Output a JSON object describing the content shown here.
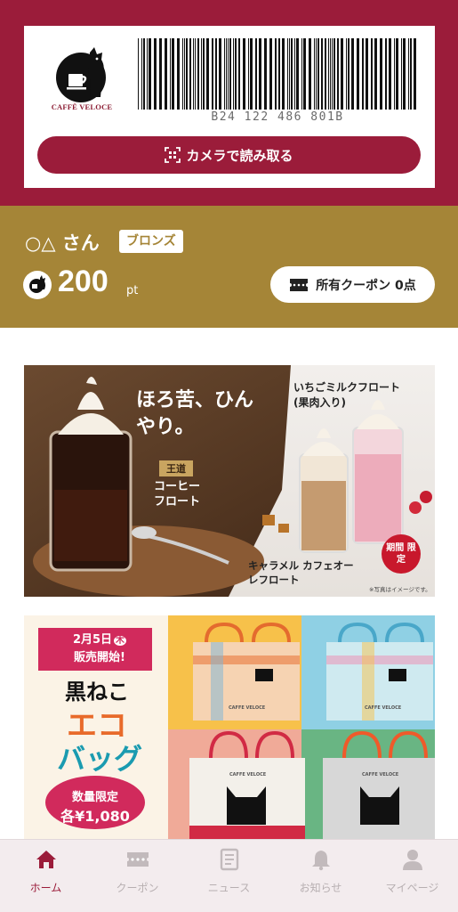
{
  "barcode": {
    "number": "B24 122 486 801B",
    "scan_button_label": "カメラで読み取る"
  },
  "brand": {
    "logo_text": "CAFFÈ VELOCE",
    "primary_color": "#9b1c3a",
    "gold_color": "#a58537"
  },
  "member": {
    "name": "○△ さん",
    "rank": "ブロンズ",
    "points": "200",
    "points_unit": "pt",
    "coupon_label": "所有クーポン 0点"
  },
  "banners": {
    "float": {
      "headline": "ほろ苦、ひんやり。",
      "item1_tag": "王道",
      "item1": "コーヒー フロート",
      "item2": "いちごミルクフロート",
      "item2_sub": "(果肉入り)",
      "item3": "キャラメル カフェオーレフロート",
      "limited": "期間 限定",
      "note": "※写真はイメージです。"
    },
    "ecobag": {
      "date": "2月5日",
      "day": "木",
      "release": "販売開始!",
      "title1": "黒ねこ",
      "title2": "エコ",
      "title3": "バッグ",
      "limited": "数量限定",
      "price": "各¥1,080",
      "bag_brand": "CAFFE VELOCE"
    }
  },
  "tabs": [
    {
      "label": "ホーム",
      "icon": "home-icon",
      "active": true
    },
    {
      "label": "クーポン",
      "icon": "ticket-icon",
      "active": false
    },
    {
      "label": "ニュース",
      "icon": "news-icon",
      "active": false
    },
    {
      "label": "お知らせ",
      "icon": "bell-icon",
      "active": false
    },
    {
      "label": "マイページ",
      "icon": "person-icon",
      "active": false
    }
  ]
}
